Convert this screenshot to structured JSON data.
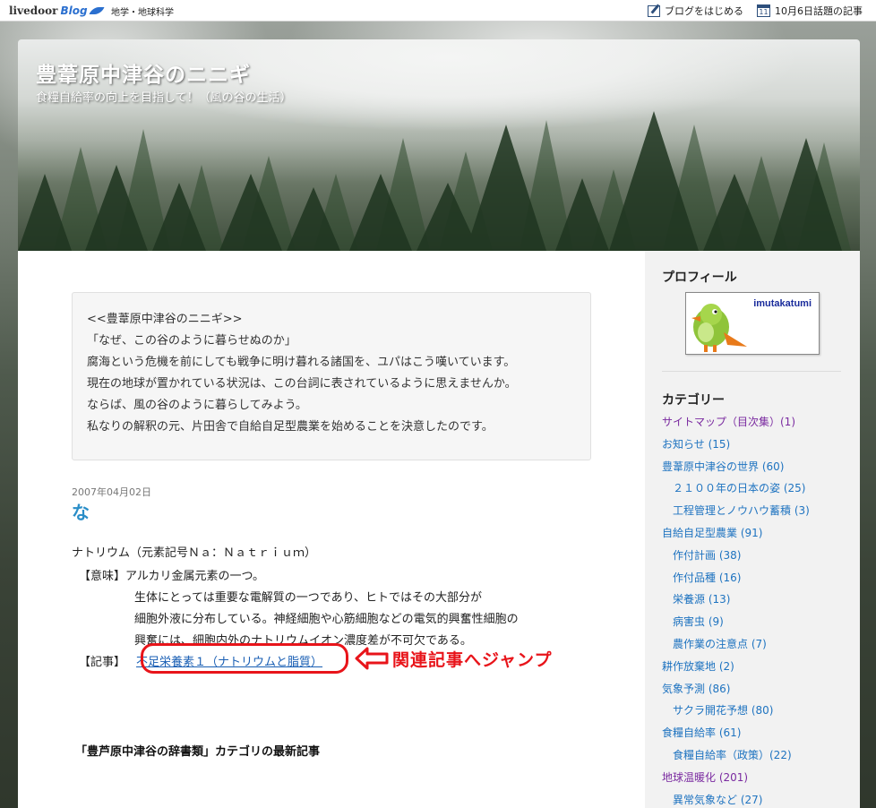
{
  "topbar": {
    "logo_text": "livedoor",
    "logo_blog": "Blog",
    "genre": "地学・地球科学",
    "start_blog": "ブログをはじめる",
    "calendar_day": "11",
    "today_topics": "10月6日話題の記事"
  },
  "header": {
    "title": "豊葦原中津谷のニニギ",
    "subtitle": "食糧自給率の向上を目指して！（風の谷の生活）"
  },
  "intro": {
    "lines": [
      "<<豊葦原中津谷のニニギ>>",
      "",
      "「なぜ、この谷のように暮らせぬのか」",
      "腐海という危機を前にしても戦争に明け暮れる諸国を、ユパはこう嘆いています。",
      "現在の地球が置かれている状況は、この台詞に表されているように思えませんか。",
      "ならば、風の谷のように暮らしてみよう。",
      "私なりの解釈の元、片田舎で自給自足型農業を始めることを決意したのです。"
    ]
  },
  "entry": {
    "date": "2007年04月02日",
    "title": "な",
    "heading": "ナトリウム（元素記号Ｎａ：Ｎａｔｒｉｕｍ）",
    "meaning_label": "【意味】",
    "meaning_1": "アルカリ金属元素の一つ。",
    "meaning_2": "生体にとっては重要な電解質の一つであり、ヒトではその大部分が",
    "meaning_3": "細胞外液に分布している。神経細胞や心筋細胞などの電気的興奮性細胞の",
    "meaning_4": "興奮には、細胞内外のナトリウムイオン濃度差が不可欠である。",
    "article_label": "【記事】",
    "article_link": "不足栄養素１（ナトリウムと脂質）",
    "annotation": "関連記事へジャンプ",
    "latest_heading": "「豊芦原中津谷の辞書類」カテゴリの最新記事"
  },
  "sidebar": {
    "profile_heading": "プロフィール",
    "profile_name": "imutakatumi",
    "category_heading": "カテゴリー",
    "categories": [
      {
        "label": "サイトマップ（目次集）(1)",
        "sub": false,
        "color": "#7a2aa0"
      },
      {
        "label": "お知らせ (15)",
        "sub": false,
        "color": "#1e73c0"
      },
      {
        "label": "豊葦原中津谷の世界 (60)",
        "sub": false,
        "color": "#1e73c0"
      },
      {
        "label": "２１００年の日本の姿 (25)",
        "sub": true,
        "color": "#1e73c0"
      },
      {
        "label": "工程管理とノウハウ蓄積 (3)",
        "sub": true,
        "color": "#1e73c0"
      },
      {
        "label": "自給自足型農業 (91)",
        "sub": false,
        "color": "#1e73c0"
      },
      {
        "label": "作付計画 (38)",
        "sub": true,
        "color": "#1e73c0"
      },
      {
        "label": "作付品種 (16)",
        "sub": true,
        "color": "#1e73c0"
      },
      {
        "label": "栄養源 (13)",
        "sub": true,
        "color": "#1e73c0"
      },
      {
        "label": "病害虫 (9)",
        "sub": true,
        "color": "#1e73c0"
      },
      {
        "label": "農作業の注意点 (7)",
        "sub": true,
        "color": "#1e73c0"
      },
      {
        "label": "耕作放棄地 (2)",
        "sub": false,
        "color": "#1e73c0"
      },
      {
        "label": "気象予測 (86)",
        "sub": false,
        "color": "#1e73c0"
      },
      {
        "label": "サクラ開花予想 (80)",
        "sub": true,
        "color": "#1e73c0"
      },
      {
        "label": "食糧自給率 (61)",
        "sub": false,
        "color": "#1e73c0"
      },
      {
        "label": "食糧自給率（政策）(22)",
        "sub": true,
        "color": "#1e73c0"
      },
      {
        "label": "地球温暖化 (201)",
        "sub": false,
        "color": "#7a2aa0"
      },
      {
        "label": "異常気象など (27)",
        "sub": true,
        "color": "#1e73c0"
      }
    ]
  },
  "colors": {
    "accent": "#2a8ec8",
    "annotation_red": "#e8141a",
    "link": "#1e73c0",
    "visited": "#7a2aa0"
  }
}
